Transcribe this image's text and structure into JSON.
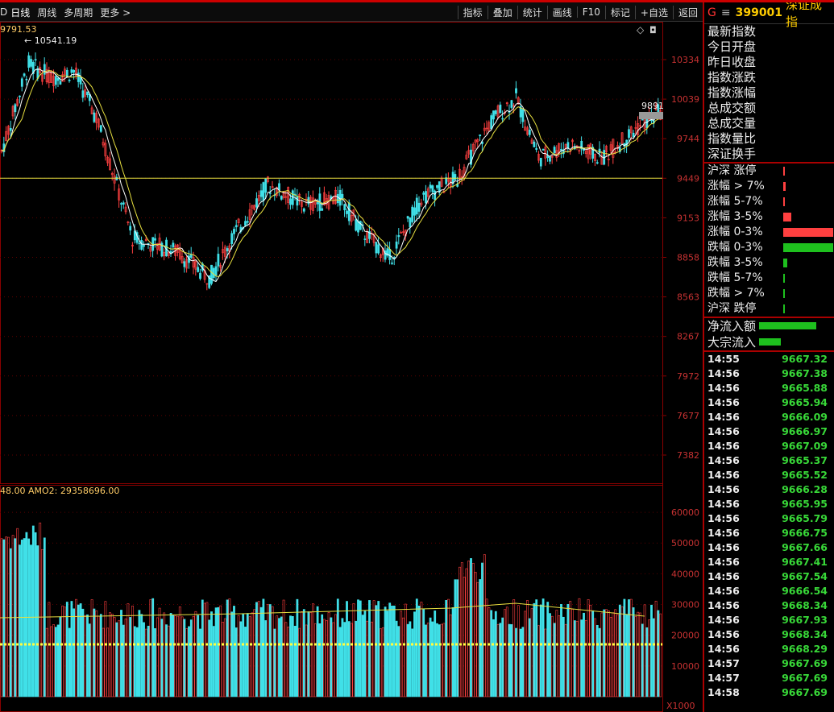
{
  "toolbar": {
    "left_clip": "D",
    "tabs": [
      "日线",
      "周线",
      "多周期",
      "更多 >"
    ],
    "right_buttons": [
      "指标",
      "叠加",
      "统计",
      "画线",
      "F10",
      "标记",
      "+自选",
      "返回"
    ]
  },
  "chart": {
    "label_high": "9791.53",
    "label_peak": "10541.19",
    "label_last": "9891",
    "price_axis": [
      "10334",
      "10039",
      "9744",
      "9449",
      "9153",
      "8858",
      "8563",
      "8267",
      "7972",
      "7677",
      "7382"
    ],
    "volume_header": "48.00  AMO2: 29358696.00",
    "volume_axis": [
      "60000",
      "50000",
      "40000",
      "30000",
      "20000",
      "10000"
    ],
    "volume_unit": "X1000",
    "colors": {
      "up": "#ff4040",
      "down": "#40e0e8",
      "ma_fast": "#ffffff",
      "ma_slow": "#e8e040",
      "grid": "#5a0000",
      "frame": "#8a0000",
      "axis_text": "#c83232"
    }
  },
  "side": {
    "badge": "G",
    "menu_icon": "menu-icon",
    "code": "399001",
    "name": "深证成指",
    "fields": [
      "最新指数",
      "今日开盘",
      "昨日收盘",
      "指数涨跌",
      "指数涨幅",
      "总成交额",
      "总成交量",
      "指数量比",
      "深证换手"
    ],
    "stats": [
      {
        "label": "沪深 涨停",
        "color": "#ff4040",
        "fraction": 0.02
      },
      {
        "label": "涨幅 > 7%",
        "color": "#ff4040",
        "fraction": 0.05
      },
      {
        "label": "涨幅 5-7%",
        "color": "#ff4040",
        "fraction": 0.02
      },
      {
        "label": "涨幅 3-5%",
        "color": "#ff4040",
        "fraction": 0.16
      },
      {
        "label": "涨幅 0-3%",
        "color": "#ff4040",
        "fraction": 1.0
      },
      {
        "label": "跌幅 0-3%",
        "color": "#1ec01e",
        "fraction": 1.0
      },
      {
        "label": "跌幅 3-5%",
        "color": "#1ec01e",
        "fraction": 0.08
      },
      {
        "label": "跌幅 5-7%",
        "color": "#1ec01e",
        "fraction": 0.02
      },
      {
        "label": "跌幅 > 7%",
        "color": "#1ec01e",
        "fraction": 0.02
      },
      {
        "label": "沪深 跌停",
        "color": "#1ec01e",
        "fraction": 0.02
      }
    ],
    "flows": [
      {
        "label": "净流入额",
        "fraction": 0.42
      },
      {
        "label": "大宗流入",
        "fraction": 0.16
      }
    ],
    "ticks": [
      {
        "time": "14:55",
        "price": "9667.32"
      },
      {
        "time": "14:56",
        "price": "9667.38"
      },
      {
        "time": "14:56",
        "price": "9665.88"
      },
      {
        "time": "14:56",
        "price": "9665.94"
      },
      {
        "time": "14:56",
        "price": "9666.09"
      },
      {
        "time": "14:56",
        "price": "9666.97"
      },
      {
        "time": "14:56",
        "price": "9667.09"
      },
      {
        "time": "14:56",
        "price": "9665.37"
      },
      {
        "time": "14:56",
        "price": "9665.52"
      },
      {
        "time": "14:56",
        "price": "9666.28"
      },
      {
        "time": "14:56",
        "price": "9665.95"
      },
      {
        "time": "14:56",
        "price": "9665.79"
      },
      {
        "time": "14:56",
        "price": "9666.75"
      },
      {
        "time": "14:56",
        "price": "9667.66"
      },
      {
        "time": "14:56",
        "price": "9667.41"
      },
      {
        "time": "14:56",
        "price": "9667.54"
      },
      {
        "time": "14:56",
        "price": "9666.54"
      },
      {
        "time": "14:56",
        "price": "9668.34"
      },
      {
        "time": "14:56",
        "price": "9667.93"
      },
      {
        "time": "14:56",
        "price": "9668.34"
      },
      {
        "time": "14:56",
        "price": "9668.29"
      },
      {
        "time": "14:57",
        "price": "9667.69"
      },
      {
        "time": "14:57",
        "price": "9667.69"
      },
      {
        "time": "14:58",
        "price": "9667.69"
      }
    ]
  }
}
